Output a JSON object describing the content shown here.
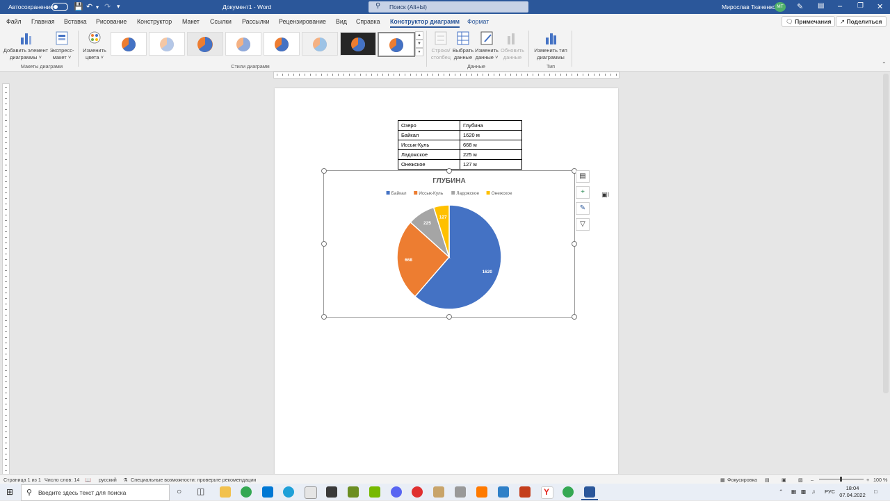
{
  "titlebar": {
    "autosave_label": "Автосохранение",
    "autosave_state": "off",
    "doc_title": "Документ1 - Word",
    "search_placeholder": "Поиск (Alt+Ы)",
    "user_name": "Мирослав Ткаченко",
    "user_initials": "МТ",
    "colors": {
      "bar": "#2b579a"
    }
  },
  "menu": {
    "tabs": [
      "Файл",
      "Главная",
      "Вставка",
      "Рисование",
      "Конструктор",
      "Макет",
      "Ссылки",
      "Рассылки",
      "Рецензирование",
      "Вид",
      "Справка",
      "Конструктор диаграмм",
      "Формат"
    ],
    "active_tab": "Конструктор диаграмм",
    "comments_btn": "Примечания",
    "share_btn": "Поделиться"
  },
  "ribbon": {
    "add_element": [
      "Добавить элемент",
      "диаграммы ˅"
    ],
    "quick_layout": [
      "Экспресс-",
      "макет ˅"
    ],
    "group_layouts": "Макеты диаграмм",
    "change_colors": [
      "Изменить",
      "цвета ˅"
    ],
    "group_styles": "Стили диаграмм",
    "switch_row_col": [
      "Строка/",
      "столбец"
    ],
    "select_data": [
      "Выбрать",
      "данные"
    ],
    "edit_data": [
      "Изменить",
      "данные ˅"
    ],
    "refresh_data": [
      "Обновить",
      "данные"
    ],
    "group_data": "Данные",
    "change_type": [
      "Изменить тип",
      "диаграммы"
    ],
    "group_type": "Тип"
  },
  "document": {
    "table": [
      [
        "Озеро",
        "Глубина"
      ],
      [
        "Байкал",
        "1620 м"
      ],
      [
        "Иссык-Куль",
        "668 м"
      ],
      [
        "Ладожское",
        "225 м"
      ],
      [
        "Онежское",
        "127 м"
      ]
    ]
  },
  "chart_data": {
    "type": "pie",
    "title": "ГЛУБИНА",
    "categories": [
      "Байкал",
      "Иссык-Куль",
      "Ладожское",
      "Онежское"
    ],
    "values": [
      1620,
      668,
      225,
      127
    ],
    "colors": [
      "#4472c4",
      "#ed7d31",
      "#a5a5a5",
      "#ffc000"
    ],
    "legend_position": "top",
    "data_labels": true
  },
  "statusbar": {
    "page": "Страница 1 из 1",
    "words": "Число слов: 14",
    "language": "русский",
    "accessibility": "Специальные возможности: проверьте рекомендации",
    "focus": "Фокусировка",
    "zoom": "100 %"
  },
  "taskbar": {
    "search_placeholder": "Введите здесь текст для поиска",
    "language": "РУС",
    "time": "18:04",
    "date": "07.04.2022"
  }
}
